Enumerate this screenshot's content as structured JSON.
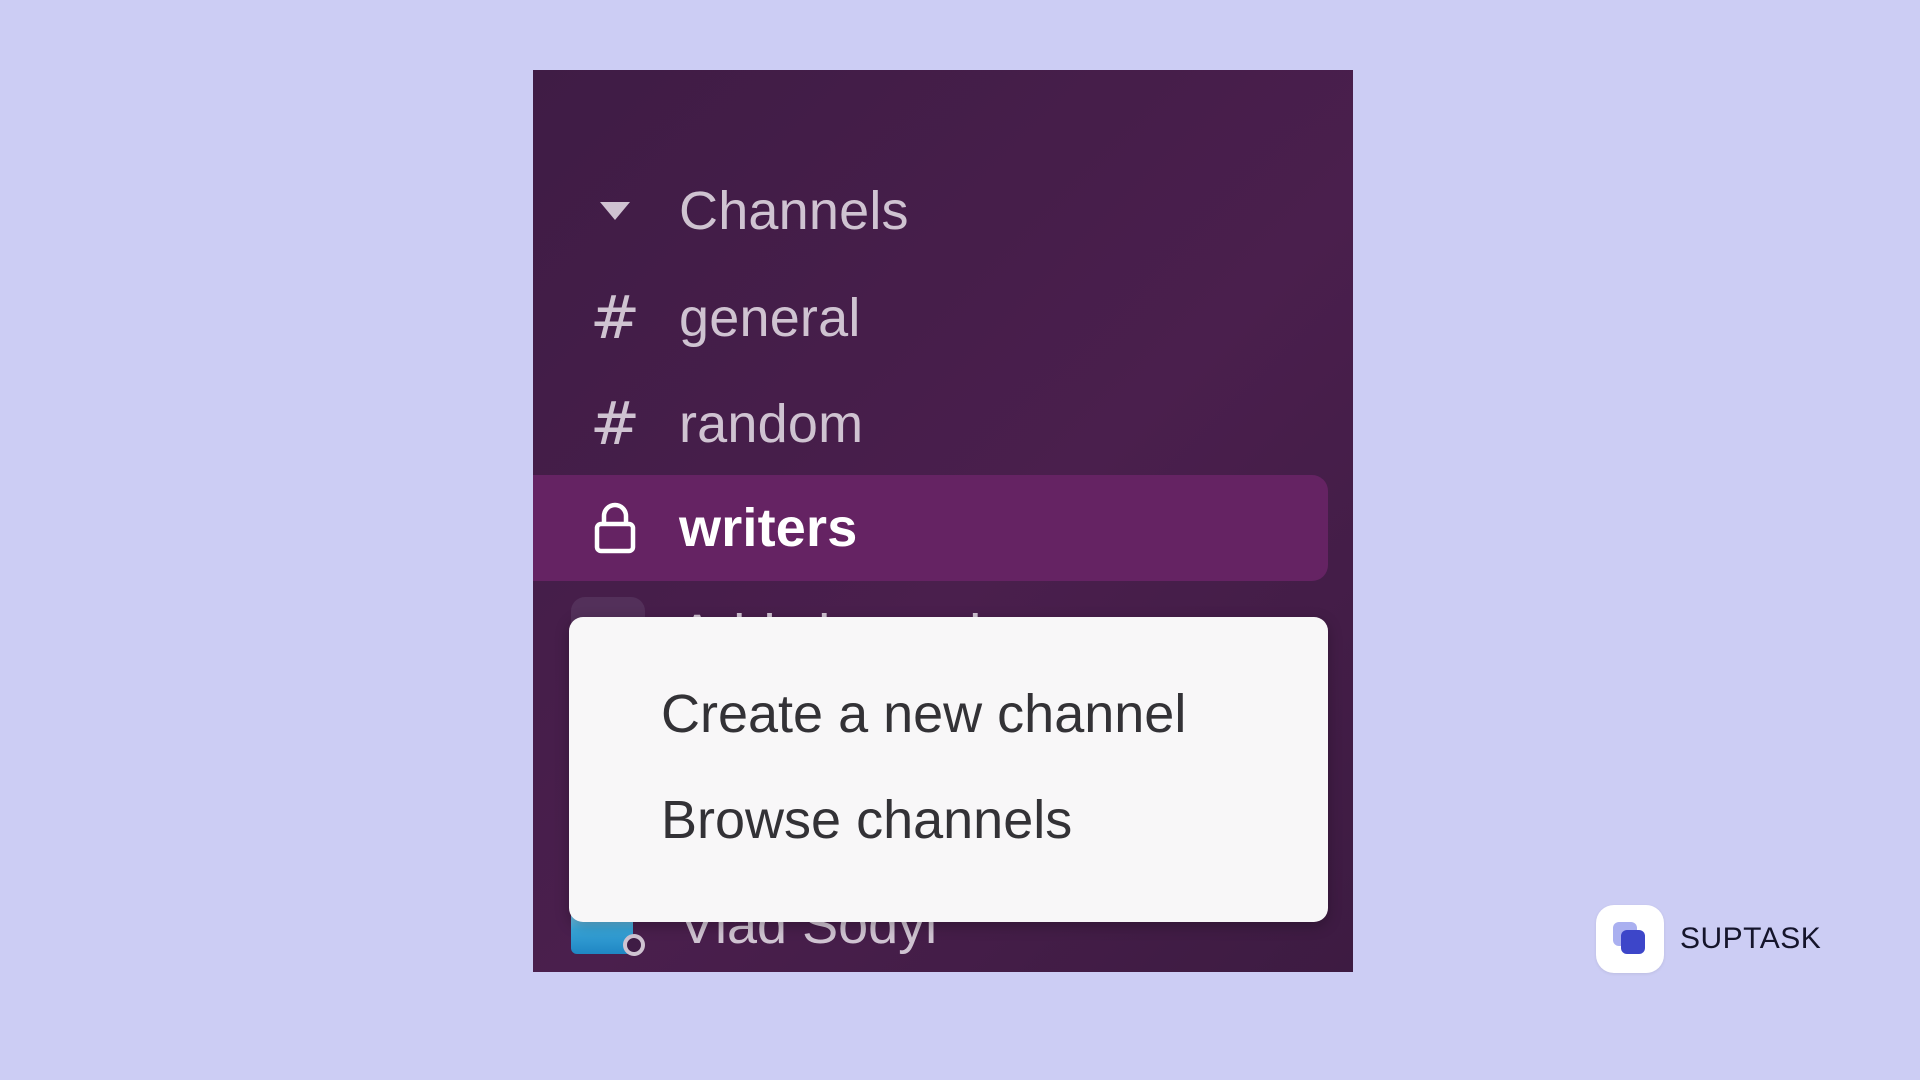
{
  "sidebar": {
    "section_title": "Channels",
    "channels": [
      {
        "name": "general",
        "icon": "hash-icon"
      },
      {
        "name": "random",
        "icon": "hash-icon"
      },
      {
        "name": "writers",
        "icon": "lock-icon",
        "selected": true
      }
    ],
    "add_channels_label": "Add channels",
    "user_name": "Vlad Sodyl"
  },
  "menu": {
    "items": [
      {
        "label": "Create a new channel"
      },
      {
        "label": "Browse channels"
      }
    ]
  },
  "brand": {
    "name": "SUPTASK"
  },
  "colors": {
    "background": "#cccdf4",
    "sidebar": "#3f1c45",
    "selected_row": "#652363",
    "menu_background": "#f8f7f8",
    "brand_accent": "#4b56d6"
  }
}
